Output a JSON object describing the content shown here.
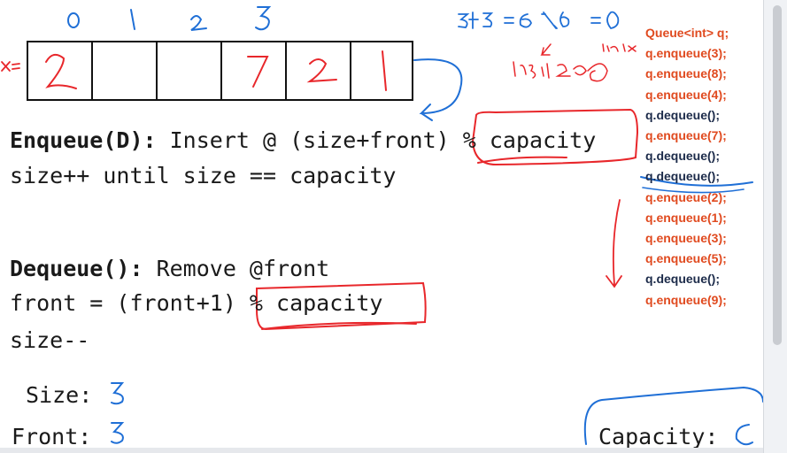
{
  "whiteboard": {
    "index_labels": [
      "0",
      "1",
      "2",
      "3"
    ],
    "array_label": "x=",
    "array_cells": [
      "2",
      "",
      "",
      "7",
      "2",
      "1"
    ],
    "note_calc": "3+3 =6 %6 =0",
    "note_index": "index",
    "note_insert": "insert 2@0"
  },
  "text": {
    "enqueue_title": "Enqueue(D):",
    "enqueue_rest": " Insert @ (size+front) % capacity",
    "enqueue_line2": "size++ until size == capacity",
    "dequeue_title": "Dequeue():",
    "dequeue_rest": " Remove @front",
    "dequeue_line2": "front = (front+1) % capacity",
    "dequeue_line3": "size--",
    "size_label": "Size:",
    "size_value": "3",
    "front_label": "Front:",
    "front_value": "3",
    "capacity_label": "Capacity:",
    "capacity_value": "6"
  },
  "code_sequence": [
    {
      "text": "Queue<int> q;",
      "color": "#e04a1f"
    },
    {
      "text": "q.enqueue(3);",
      "color": "#e04a1f"
    },
    {
      "text": "q.enqueue(8);",
      "color": "#e04a1f"
    },
    {
      "text": "q.enqueue(4);",
      "color": "#e04a1f"
    },
    {
      "text": "q.dequeue();",
      "color": "#1c2b4a"
    },
    {
      "text": "q.enqueue(7);",
      "color": "#e04a1f"
    },
    {
      "text": "q.dequeue();",
      "color": "#1c2b4a"
    },
    {
      "text": "q.dequeue();",
      "color": "#1c2b4a"
    },
    {
      "text": "q.enqueue(2);",
      "color": "#e04a1f"
    },
    {
      "text": "q.enqueue(1);",
      "color": "#e04a1f"
    },
    {
      "text": "q.enqueue(3);",
      "color": "#e04a1f"
    },
    {
      "text": "q.enqueue(5);",
      "color": "#e04a1f"
    },
    {
      "text": "q.dequeue();",
      "color": "#1c2b4a"
    },
    {
      "text": "q.enqueue(9);",
      "color": "#e04a1f"
    }
  ],
  "colors": {
    "ink_red": "#e8272b",
    "ink_blue": "#1f6fd6",
    "code_red": "#e04a1f",
    "code_navy": "#1c2b4a"
  }
}
